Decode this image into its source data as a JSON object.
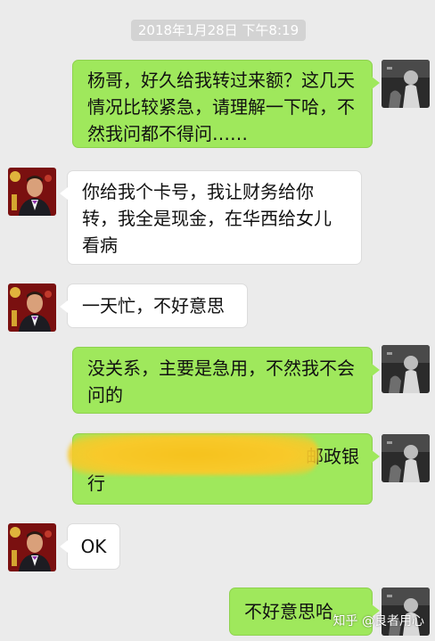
{
  "chat": {
    "timestamp": "2018年1月28日 下午8:19",
    "messages": [
      {
        "side": "sent",
        "text": "杨哥，好久给我转过来额？这几天情况比较紧急，请理解一下哈，不然我问都不得问……"
      },
      {
        "side": "received",
        "text": "你给我个卡号，我让财务给你转，我全是现金，在华西给女儿看病"
      },
      {
        "side": "received",
        "text": "一天忙，不好意思"
      },
      {
        "side": "sent",
        "text": "没关系，主要是急用，不然我不会问的"
      },
      {
        "side": "sent",
        "text": "邮政银行",
        "visible_line1": "邮政银",
        "visible_line2": "行",
        "redacted": true
      },
      {
        "side": "received",
        "text": "OK"
      },
      {
        "side": "sent",
        "text": "不好意思哈"
      }
    ]
  },
  "watermark": "知乎 @良者用心",
  "colors": {
    "background": "#ebebeb",
    "sent_bubble": "#9fe85c",
    "received_bubble": "#ffffff",
    "redaction": "#f6c21d"
  },
  "icons": {
    "sent_avatar": "self-avatar-icon",
    "received_avatar": "contact-avatar-icon"
  }
}
